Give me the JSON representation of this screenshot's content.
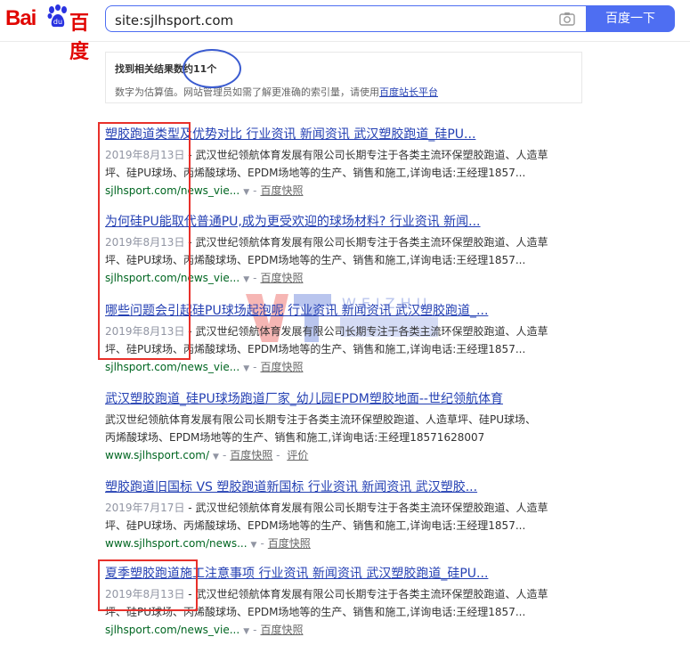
{
  "header": {
    "logo_latin": "Bai",
    "logo_cn": "百度",
    "search_query": "site:sjlhsport.com",
    "search_button": "百度一下",
    "camera_icon": "camera-icon",
    "brand_color": "#4e6ef2"
  },
  "tip": {
    "title": "找到相关结果数约11个",
    "desc_prefix": "数字为估算值。网站管理员如需了解更准确的索引量，请使用",
    "desc_link": "百度站长平台"
  },
  "watermark": {
    "text": "WEIZHU"
  },
  "results": [
    {
      "title": "塑胶跑道类型及优势对比 行业资讯 新闻资讯 武汉塑胶跑道_硅PU...",
      "date": "2019年8月13日",
      "abstract_line1": "武汉世纪领航体育发展有限公司长期专注于各类主流环保塑胶跑道、人造草",
      "abstract_line2": "坪、硅PU球场、丙烯酸球场、EPDM场地等的生产、销售和施工,详询电话:王经理1857...",
      "url": "sjlhsport.com/news_vie...",
      "cache": "百度快照"
    },
    {
      "title": "为何硅PU能取代普通PU,成为更受欢迎的球场材料? 行业资讯 新闻...",
      "date": "2019年8月13日",
      "abstract_line1": "武汉世纪领航体育发展有限公司长期专注于各类主流环保塑胶跑道、人造草",
      "abstract_line2": "坪、硅PU球场、丙烯酸球场、EPDM场地等的生产、销售和施工,详询电话:王经理1857...",
      "url": "sjlhsport.com/news_vie...",
      "cache": "百度快照"
    },
    {
      "title": "哪些问题会引起硅PU球场起泡呢 行业资讯 新闻资讯 武汉塑胶跑道_...",
      "date": "2019年8月13日",
      "abstract_line1": "武汉世纪领航体育发展有限公司长期专注于各类主流环保塑胶跑道、人造草",
      "abstract_line2": "坪、硅PU球场、丙烯酸球场、EPDM场地等的生产、销售和施工,详询电话:王经理1857...",
      "url": "sjlhsport.com/news_vie...",
      "cache": "百度快照"
    },
    {
      "title": "武汉塑胶跑道_硅PU球场跑道厂家_幼儿园EPDM塑胶地面--世纪领航体育",
      "abstract_line1": "武汉世纪领航体育发展有限公司长期专注于各类主流环保塑胶跑道、人造草坪、硅PU球场、",
      "abstract_line2": "丙烯酸球场、EPDM场地等的生产、销售和施工,详询电话:王经理18571628007",
      "url": "www.sjlhsport.com/",
      "cache": "百度快照",
      "review": "评价"
    },
    {
      "title": "塑胶跑道旧国标 VS 塑胶跑道新国标 行业资讯 新闻资讯 武汉塑胶...",
      "date": "2019年7月17日",
      "abstract_line1": "武汉世纪领航体育发展有限公司长期专注于各类主流环保塑胶跑道、人造草",
      "abstract_line2": "坪、硅PU球场、丙烯酸球场、EPDM场地等的生产、销售和施工,详询电话:王经理1857...",
      "url": "www.sjlhsport.com/news...",
      "cache": "百度快照"
    },
    {
      "title": "夏季塑胶跑道施工注意事项 行业资讯 新闻资讯 武汉塑胶跑道_硅PU...",
      "date": "2019年8月13日",
      "abstract_line1": "武汉世纪领航体育发展有限公司长期专注于各类主流环保塑胶跑道、人造草",
      "abstract_line2": "坪、硅PU球场、丙烯酸球场、EPDM场地等的生产、销售和施工,详询电话:王经理1857...",
      "url": "sjlhsport.com/news_vie...",
      "cache": "百度快照"
    }
  ]
}
